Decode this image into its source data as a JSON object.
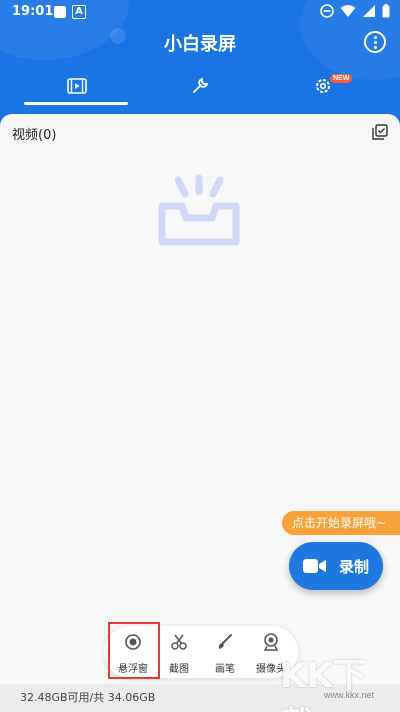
{
  "status_bar": {
    "time": "19:01",
    "a_icon_letter": "A"
  },
  "app": {
    "title": "小白录屏"
  },
  "tabs": [
    {
      "id": "video",
      "icon": "video-list-icon",
      "active": true
    },
    {
      "id": "tools",
      "icon": "wrench-icon",
      "active": false
    },
    {
      "id": "settings",
      "icon": "gear-icon",
      "active": false,
      "badge": "NEW"
    }
  ],
  "video_section": {
    "label": "视频(0)"
  },
  "hint": {
    "text": "点击开始录屏哦~"
  },
  "record_button": {
    "label": "录制"
  },
  "toolbar": {
    "items": [
      {
        "label": "悬浮窗",
        "icon": "floating-window-icon"
      },
      {
        "label": "截图",
        "icon": "scissors-icon"
      },
      {
        "label": "画笔",
        "icon": "brush-icon"
      },
      {
        "label": "摄像头",
        "icon": "camera-icon"
      }
    ]
  },
  "storage": {
    "text": "32.48GB可用/共 34.06GB"
  },
  "watermark": {
    "text": "KK下载",
    "site": "www.kkx.net"
  },
  "colors": {
    "header": "#1b74e4",
    "accent": "#1f77e0",
    "hint": "#f7a23b",
    "badge": "#ff5a3c",
    "highlight": "#e53935"
  }
}
